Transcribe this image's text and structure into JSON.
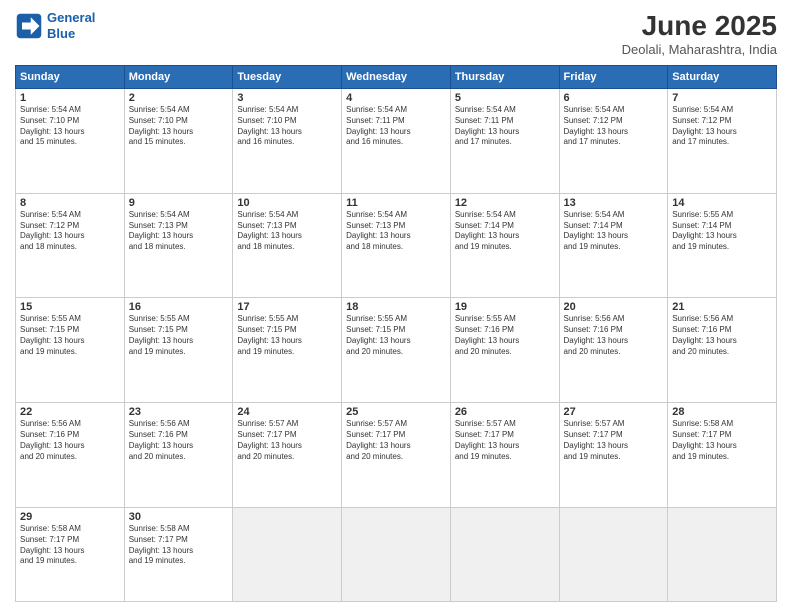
{
  "header": {
    "logo_line1": "General",
    "logo_line2": "Blue",
    "title": "June 2025",
    "subtitle": "Deolali, Maharashtra, India"
  },
  "weekdays": [
    "Sunday",
    "Monday",
    "Tuesday",
    "Wednesday",
    "Thursday",
    "Friday",
    "Saturday"
  ],
  "weeks": [
    [
      {
        "day": "1",
        "info": "Sunrise: 5:54 AM\nSunset: 7:10 PM\nDaylight: 13 hours\nand 15 minutes."
      },
      {
        "day": "2",
        "info": "Sunrise: 5:54 AM\nSunset: 7:10 PM\nDaylight: 13 hours\nand 15 minutes."
      },
      {
        "day": "3",
        "info": "Sunrise: 5:54 AM\nSunset: 7:10 PM\nDaylight: 13 hours\nand 16 minutes."
      },
      {
        "day": "4",
        "info": "Sunrise: 5:54 AM\nSunset: 7:11 PM\nDaylight: 13 hours\nand 16 minutes."
      },
      {
        "day": "5",
        "info": "Sunrise: 5:54 AM\nSunset: 7:11 PM\nDaylight: 13 hours\nand 17 minutes."
      },
      {
        "day": "6",
        "info": "Sunrise: 5:54 AM\nSunset: 7:12 PM\nDaylight: 13 hours\nand 17 minutes."
      },
      {
        "day": "7",
        "info": "Sunrise: 5:54 AM\nSunset: 7:12 PM\nDaylight: 13 hours\nand 17 minutes."
      }
    ],
    [
      {
        "day": "8",
        "info": "Sunrise: 5:54 AM\nSunset: 7:12 PM\nDaylight: 13 hours\nand 18 minutes."
      },
      {
        "day": "9",
        "info": "Sunrise: 5:54 AM\nSunset: 7:13 PM\nDaylight: 13 hours\nand 18 minutes."
      },
      {
        "day": "10",
        "info": "Sunrise: 5:54 AM\nSunset: 7:13 PM\nDaylight: 13 hours\nand 18 minutes."
      },
      {
        "day": "11",
        "info": "Sunrise: 5:54 AM\nSunset: 7:13 PM\nDaylight: 13 hours\nand 18 minutes."
      },
      {
        "day": "12",
        "info": "Sunrise: 5:54 AM\nSunset: 7:14 PM\nDaylight: 13 hours\nand 19 minutes."
      },
      {
        "day": "13",
        "info": "Sunrise: 5:54 AM\nSunset: 7:14 PM\nDaylight: 13 hours\nand 19 minutes."
      },
      {
        "day": "14",
        "info": "Sunrise: 5:55 AM\nSunset: 7:14 PM\nDaylight: 13 hours\nand 19 minutes."
      }
    ],
    [
      {
        "day": "15",
        "info": "Sunrise: 5:55 AM\nSunset: 7:15 PM\nDaylight: 13 hours\nand 19 minutes."
      },
      {
        "day": "16",
        "info": "Sunrise: 5:55 AM\nSunset: 7:15 PM\nDaylight: 13 hours\nand 19 minutes."
      },
      {
        "day": "17",
        "info": "Sunrise: 5:55 AM\nSunset: 7:15 PM\nDaylight: 13 hours\nand 19 minutes."
      },
      {
        "day": "18",
        "info": "Sunrise: 5:55 AM\nSunset: 7:15 PM\nDaylight: 13 hours\nand 20 minutes."
      },
      {
        "day": "19",
        "info": "Sunrise: 5:55 AM\nSunset: 7:16 PM\nDaylight: 13 hours\nand 20 minutes."
      },
      {
        "day": "20",
        "info": "Sunrise: 5:56 AM\nSunset: 7:16 PM\nDaylight: 13 hours\nand 20 minutes."
      },
      {
        "day": "21",
        "info": "Sunrise: 5:56 AM\nSunset: 7:16 PM\nDaylight: 13 hours\nand 20 minutes."
      }
    ],
    [
      {
        "day": "22",
        "info": "Sunrise: 5:56 AM\nSunset: 7:16 PM\nDaylight: 13 hours\nand 20 minutes."
      },
      {
        "day": "23",
        "info": "Sunrise: 5:56 AM\nSunset: 7:16 PM\nDaylight: 13 hours\nand 20 minutes."
      },
      {
        "day": "24",
        "info": "Sunrise: 5:57 AM\nSunset: 7:17 PM\nDaylight: 13 hours\nand 20 minutes."
      },
      {
        "day": "25",
        "info": "Sunrise: 5:57 AM\nSunset: 7:17 PM\nDaylight: 13 hours\nand 20 minutes."
      },
      {
        "day": "26",
        "info": "Sunrise: 5:57 AM\nSunset: 7:17 PM\nDaylight: 13 hours\nand 19 minutes."
      },
      {
        "day": "27",
        "info": "Sunrise: 5:57 AM\nSunset: 7:17 PM\nDaylight: 13 hours\nand 19 minutes."
      },
      {
        "day": "28",
        "info": "Sunrise: 5:58 AM\nSunset: 7:17 PM\nDaylight: 13 hours\nand 19 minutes."
      }
    ],
    [
      {
        "day": "29",
        "info": "Sunrise: 5:58 AM\nSunset: 7:17 PM\nDaylight: 13 hours\nand 19 minutes."
      },
      {
        "day": "30",
        "info": "Sunrise: 5:58 AM\nSunset: 7:17 PM\nDaylight: 13 hours\nand 19 minutes."
      },
      {
        "day": "",
        "info": ""
      },
      {
        "day": "",
        "info": ""
      },
      {
        "day": "",
        "info": ""
      },
      {
        "day": "",
        "info": ""
      },
      {
        "day": "",
        "info": ""
      }
    ]
  ]
}
